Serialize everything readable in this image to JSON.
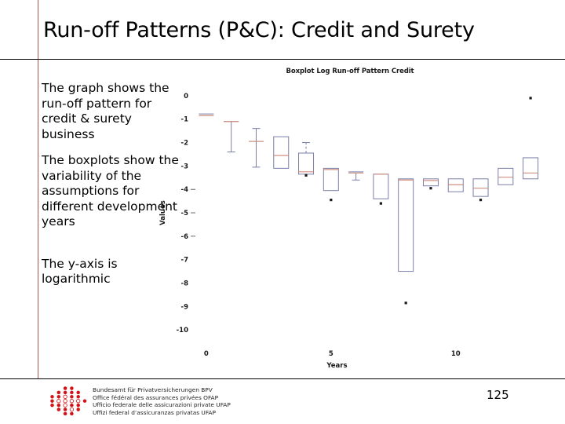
{
  "slide": {
    "title": "Run-off Patterns (P&C): Credit and Surety",
    "page_number": "125"
  },
  "bullets": [
    "The graph shows the run-off pattern for credit & surety business",
    "The boxplots show the variability of the assumptions for different development years",
    "The y-axis is logarithmic"
  ],
  "footer": {
    "logo_name": "swiss-federal-office-private-insurance-logo",
    "lines": [
      "Bundesamt für Privatversicherungen BPV",
      "Office fédéral des assurances privées OFAP",
      "Ufficio federale delle assicurazioni private UFAP",
      "Uffizi federal d’assicuranzas privatas UFAP"
    ],
    "logo_color": "#d51317"
  },
  "colors": {
    "box_stroke": "#7b7fa8",
    "median": "#d08f7e",
    "outlier": "#1a1a1a",
    "rule_red": "#b35050",
    "rule_black": "#000000"
  },
  "chart_data": {
    "type": "boxplot",
    "title": "Boxplot Log Run-off Pattern Credit",
    "xlabel": "Years",
    "ylabel": "Values",
    "xlim": [
      -0.5,
      13.5
    ],
    "ylim": [
      -10.6,
      0.4
    ],
    "xticks": [
      0,
      5,
      10
    ],
    "yticks": [
      0,
      -1,
      -2,
      -3,
      -4,
      -5,
      -6,
      -7,
      -8,
      -9,
      -10
    ],
    "grid": false,
    "categories": [
      0,
      1,
      2,
      3,
      4,
      5,
      6,
      7,
      8,
      9,
      10,
      11,
      12,
      13
    ],
    "boxes": [
      {
        "year": 0,
        "whisker_low": -0.78,
        "q1": -0.78,
        "median": -0.85,
        "q3": -0.78,
        "whisker_high": -0.78,
        "outliers": []
      },
      {
        "year": 1,
        "whisker_low": -2.4,
        "q1": -1.1,
        "median": -1.1,
        "q3": -1.1,
        "whisker_high": -1.1,
        "outliers": []
      },
      {
        "year": 2,
        "whisker_low": -3.05,
        "q1": -1.95,
        "median": -1.95,
        "q3": -1.95,
        "whisker_high": -1.4,
        "outliers": []
      },
      {
        "year": 3,
        "whisker_low": -3.1,
        "q1": -3.1,
        "median": -2.55,
        "q3": -1.75,
        "whisker_high": -1.75,
        "outliers": []
      },
      {
        "year": 4,
        "whisker_low": -3.35,
        "q1": -3.35,
        "median": -3.25,
        "q3": -2.45,
        "whisker_high": -2.0,
        "outliers": [
          -3.4
        ]
      },
      {
        "year": 5,
        "whisker_low": -4.05,
        "q1": -4.05,
        "median": -3.15,
        "q3": -3.1,
        "whisker_high": -3.1,
        "outliers": [
          -4.45
        ]
      },
      {
        "year": 6,
        "whisker_low": -3.6,
        "q1": -3.3,
        "median": -3.3,
        "q3": -3.25,
        "whisker_high": -3.25,
        "outliers": []
      },
      {
        "year": 7,
        "whisker_low": -4.4,
        "q1": -4.4,
        "median": -3.35,
        "q3": -3.35,
        "whisker_high": -3.35,
        "outliers": [
          -4.6
        ]
      },
      {
        "year": 8,
        "whisker_low": -7.5,
        "q1": -7.5,
        "median": -3.6,
        "q3": -3.55,
        "whisker_high": -3.55,
        "outliers": [
          -8.85
        ]
      },
      {
        "year": 9,
        "whisker_low": -3.85,
        "q1": -3.85,
        "median": -3.62,
        "q3": -3.55,
        "whisker_high": -3.55,
        "outliers": [
          -3.95
        ]
      },
      {
        "year": 10,
        "whisker_low": -4.1,
        "q1": -4.1,
        "median": -3.8,
        "q3": -3.55,
        "whisker_high": -3.55,
        "outliers": []
      },
      {
        "year": 11,
        "whisker_low": -4.3,
        "q1": -4.3,
        "median": -3.95,
        "q3": -3.55,
        "whisker_high": -3.55,
        "outliers": [
          -4.45
        ]
      },
      {
        "year": 12,
        "whisker_low": -3.8,
        "q1": -3.8,
        "median": -3.48,
        "q3": -3.1,
        "whisker_high": -3.1,
        "outliers": []
      },
      {
        "year": 13,
        "whisker_low": -3.55,
        "q1": -3.55,
        "median": -3.3,
        "q3": -2.65,
        "whisker_high": -2.65,
        "outliers": [
          -0.1
        ]
      }
    ]
  }
}
